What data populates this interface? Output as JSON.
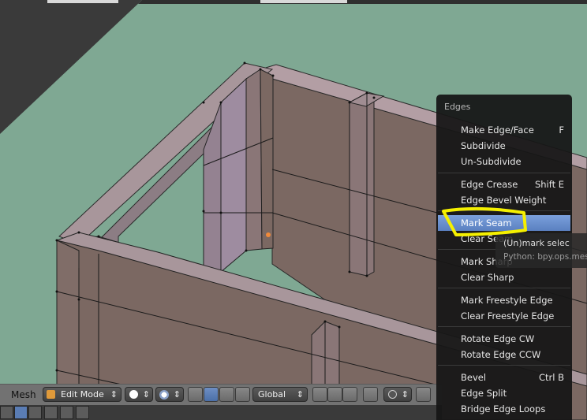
{
  "header": {
    "mesh_label": "Mesh",
    "mode_label": "Edit Mode",
    "orientation_label": "Global"
  },
  "menu": {
    "title": "Edges",
    "items": [
      {
        "label": "Make Edge/Face",
        "shortcut": "F"
      },
      {
        "label": "Subdivide",
        "shortcut": ""
      },
      {
        "label": "Un-Subdivide",
        "shortcut": ""
      },
      {
        "label": "Edge Crease",
        "shortcut": "Shift E"
      },
      {
        "label": "Edge Bevel Weight",
        "shortcut": ""
      },
      {
        "label": "Mark Seam",
        "shortcut": ""
      },
      {
        "label": "Clear Seam",
        "shortcut": ""
      },
      {
        "label": "Mark Sharp",
        "shortcut": ""
      },
      {
        "label": "Clear Sharp",
        "shortcut": ""
      },
      {
        "label": "Mark Freestyle Edge",
        "shortcut": ""
      },
      {
        "label": "Clear Freestyle Edge",
        "shortcut": ""
      },
      {
        "label": "Rotate Edge CW",
        "shortcut": ""
      },
      {
        "label": "Rotate Edge CCW",
        "shortcut": ""
      },
      {
        "label": "Bevel",
        "shortcut": "Ctrl B"
      },
      {
        "label": "Edge Split",
        "shortcut": ""
      },
      {
        "label": "Bridge Edge Loops",
        "shortcut": ""
      }
    ]
  },
  "tooltip": {
    "description": "(Un)mark selec",
    "python": "Python: bpy.ops.mesh"
  },
  "colors": {
    "viewport_bg": "#7fa893",
    "wall_face": "#7a6762",
    "wall_top": "#a8969b",
    "highlight_accent": "#f5f000",
    "menu_highlight": "#6a8fd0"
  },
  "icons": [
    "mesh-select-mode-icon",
    "shading-icon",
    "transform-manipulator-icon",
    "proportional-edit-icon",
    "snap-icon",
    "vertex-select-icon",
    "edge-select-icon",
    "face-select-icon"
  ]
}
